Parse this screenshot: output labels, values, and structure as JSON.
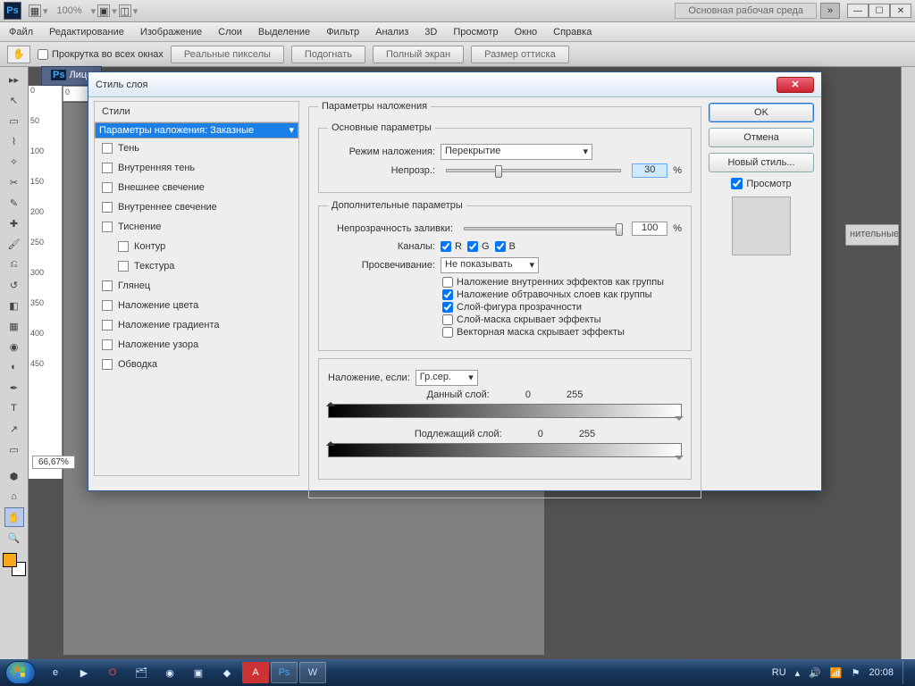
{
  "app": {
    "logo": "Ps",
    "zoom": "100%",
    "workspace": "Основная рабочая среда"
  },
  "menu": [
    "Файл",
    "Редактирование",
    "Изображение",
    "Слои",
    "Выделение",
    "Фильтр",
    "Анализ",
    "3D",
    "Просмотр",
    "Окно",
    "Справка"
  ],
  "optbar": {
    "scroll_all": "Прокрутка во всех окнах",
    "b1": "Реальные пикселы",
    "b2": "Подогнать",
    "b3": "Полный экран",
    "b4": "Размер оттиска"
  },
  "doc": {
    "tab": "Лицо",
    "zoom": "66,67%"
  },
  "ruler": [
    "0",
    "50",
    "100",
    "150",
    "200",
    "250",
    "300",
    "350",
    "400",
    "450"
  ],
  "dlg": {
    "title": "Стиль слоя",
    "styles_hdr": "Стили",
    "styles": [
      {
        "label": "Параметры наложения: Заказные",
        "sel": true,
        "nocheck": true
      },
      {
        "label": "Тень"
      },
      {
        "label": "Внутренняя тень"
      },
      {
        "label": "Внешнее свечение"
      },
      {
        "label": "Внутреннее свечение"
      },
      {
        "label": "Тиснение"
      },
      {
        "label": "Контур",
        "indent": true
      },
      {
        "label": "Текстура",
        "indent": true
      },
      {
        "label": "Глянец"
      },
      {
        "label": "Наложение цвета"
      },
      {
        "label": "Наложение градиента"
      },
      {
        "label": "Наложение узора"
      },
      {
        "label": "Обводка"
      }
    ],
    "main_legend": "Параметры наложения",
    "basic_legend": "Основные параметры",
    "blendmode_lbl": "Режим наложения:",
    "blendmode_val": "Перекрытие",
    "opacity_lbl": "Непрозр.:",
    "opacity_val": "30",
    "pct": "%",
    "adv_legend": "Дополнительные параметры",
    "fillop_lbl": "Непрозрачность заливки:",
    "fillop_val": "100",
    "channels_lbl": "Каналы:",
    "ch_r": "R",
    "ch_g": "G",
    "ch_b": "B",
    "knockout_lbl": "Просвечивание:",
    "knockout_val": "Не показывать",
    "adv_checks": [
      {
        "c": false,
        "t": "Наложение внутренних эффектов как группы"
      },
      {
        "c": true,
        "t": "Наложение обтравочных слоев как группы"
      },
      {
        "c": true,
        "t": "Слой-фигура прозрачности"
      },
      {
        "c": false,
        "t": "Слой-маска скрывает эффекты"
      },
      {
        "c": false,
        "t": "Векторная маска скрывает эффекты"
      }
    ],
    "blendif_lbl": "Наложение, если:",
    "blendif_val": "Гр.сер.",
    "this_layer": "Данный слой:",
    "under_layer": "Подлежащий слой:",
    "range_lo": "0",
    "range_hi": "255",
    "ok": "OK",
    "cancel": "Отмена",
    "newstyle": "Новый стиль...",
    "preview": "Просмотр"
  },
  "sidepanel": "нительные",
  "taskbar": {
    "lang": "RU",
    "clock": "20:08"
  }
}
